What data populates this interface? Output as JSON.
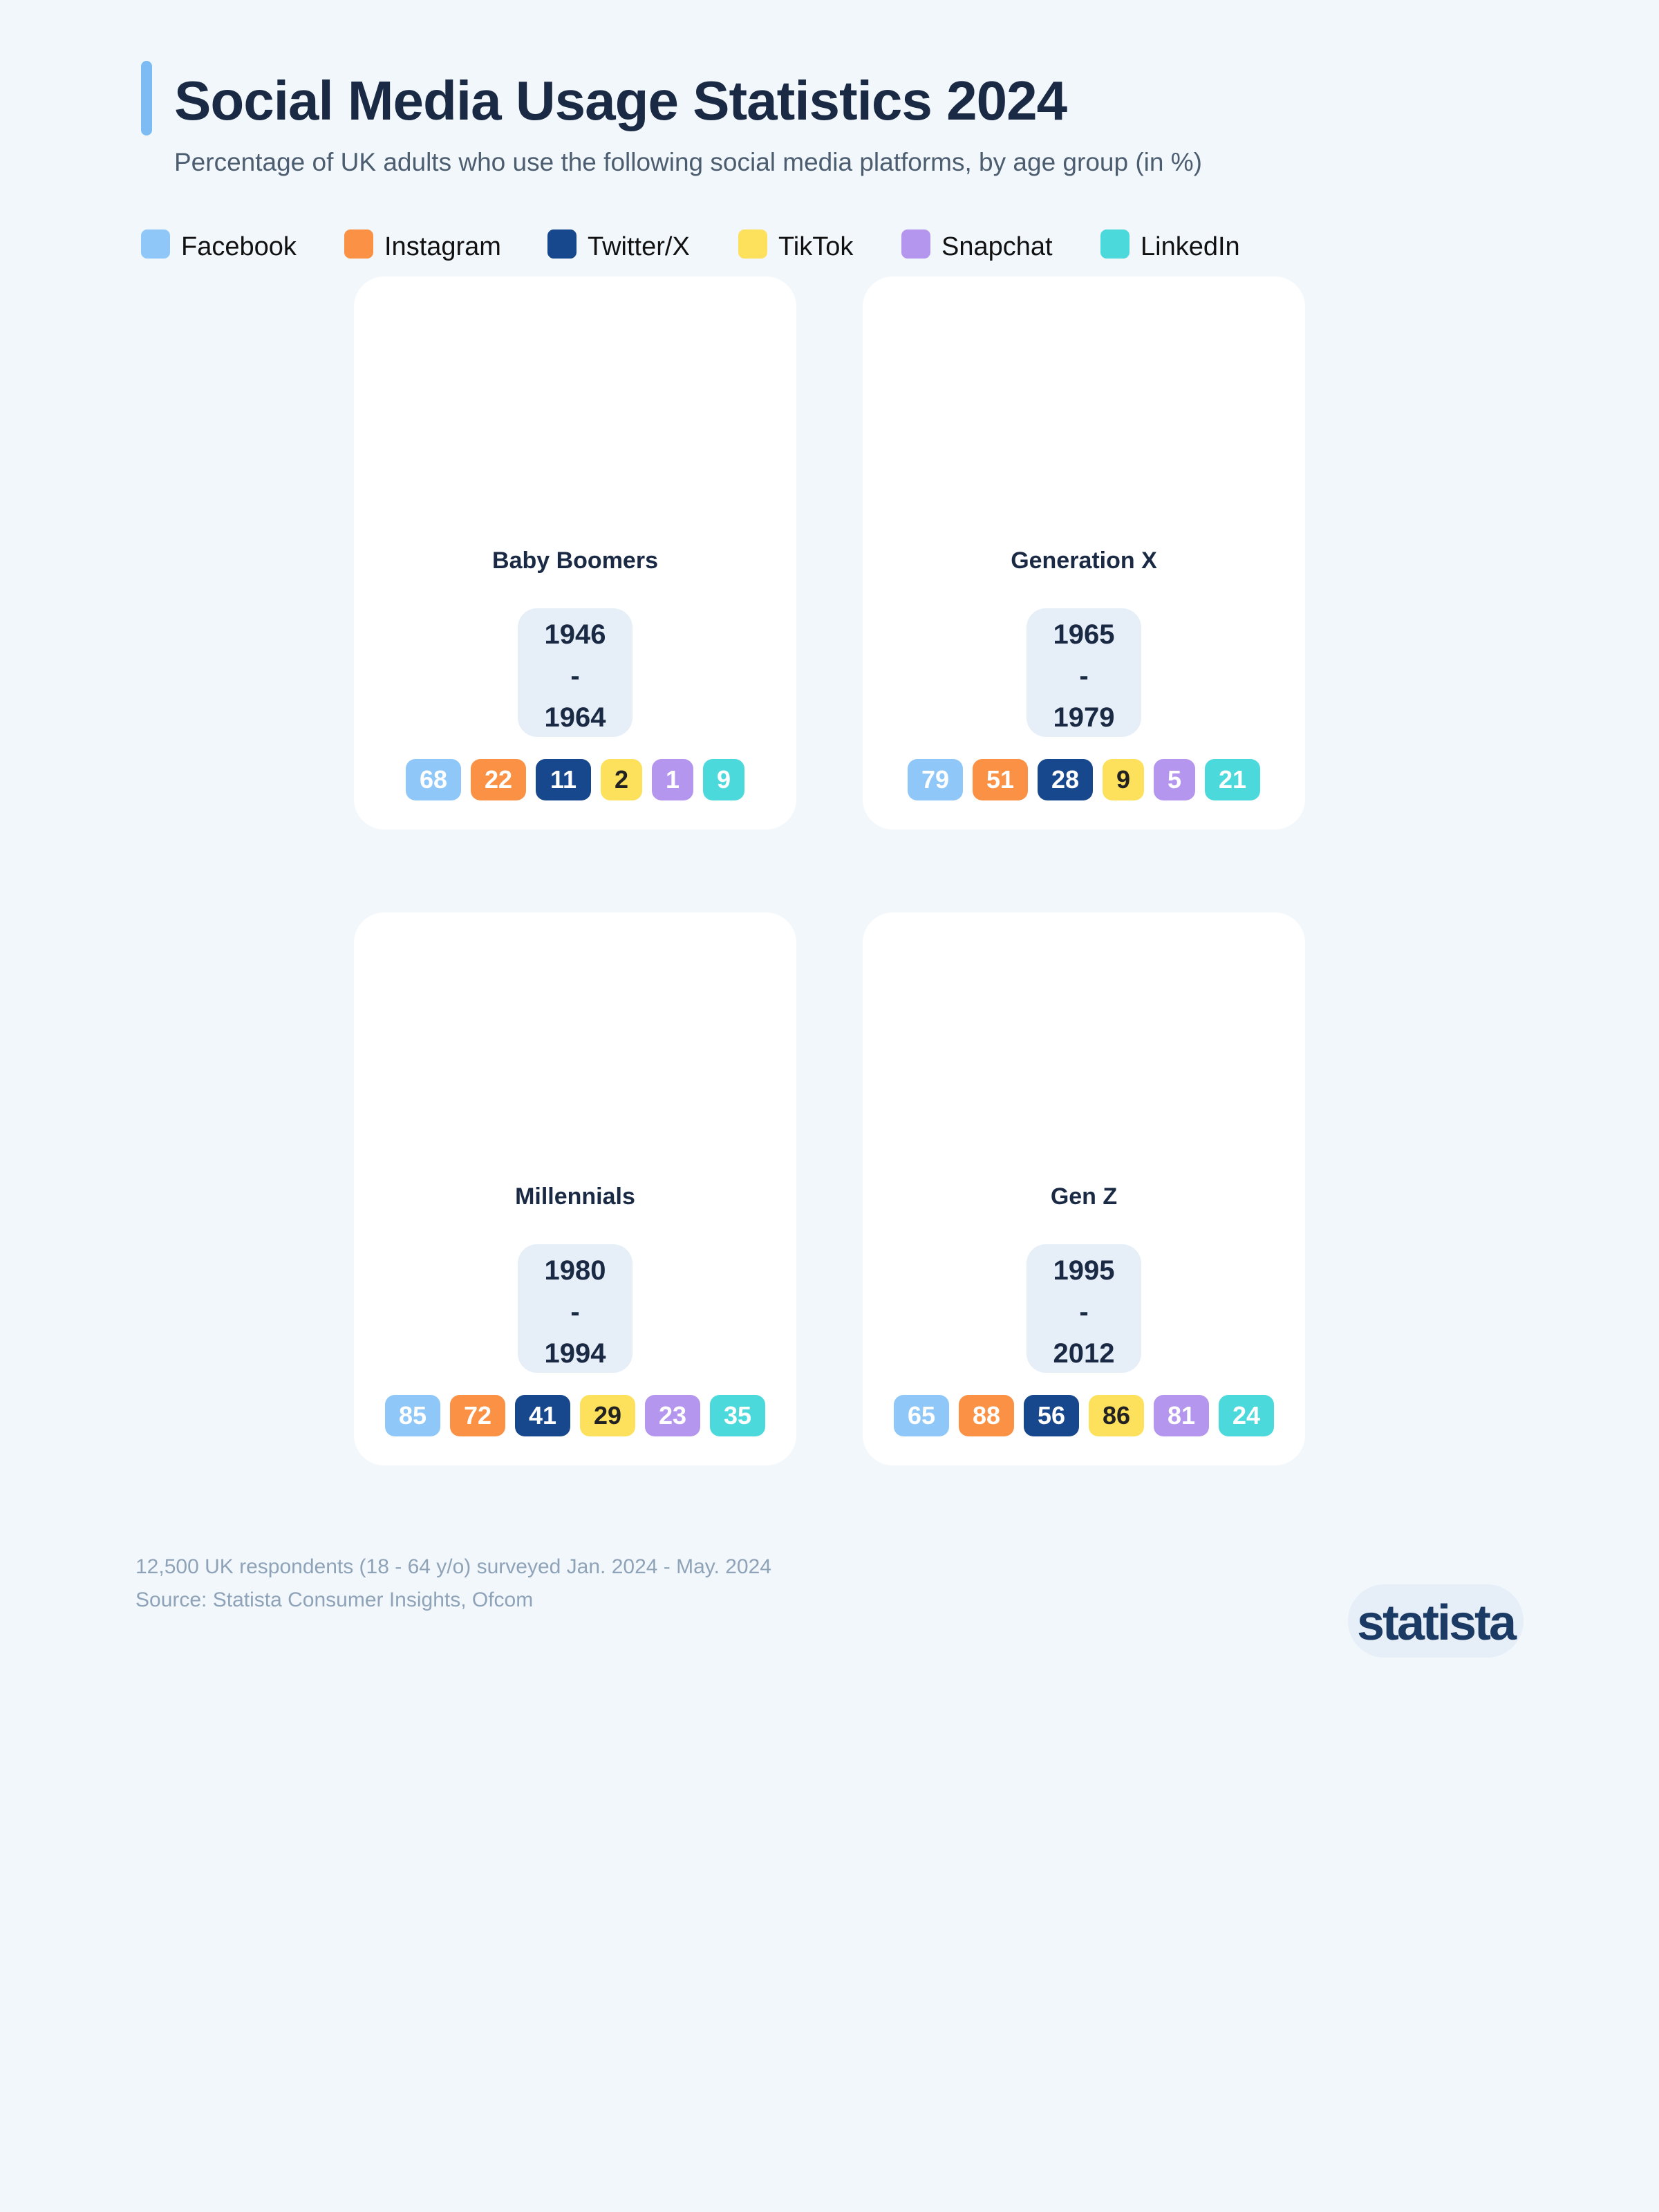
{
  "header": {
    "title": "Social Media Usage Statistics 2024",
    "subtitle": "Percentage of UK adults who use the following social media platforms, by age group (in %)",
    "accent_color": "#7dbbf5"
  },
  "chart_data": {
    "type": "table",
    "title": "Social Media Usage Statistics 2024",
    "subtitle": "Percentage of UK adults who use the following social media platforms, by age group (in %)",
    "unit": "%",
    "series": [
      {
        "name": "Facebook",
        "color": "#8fc8f8"
      },
      {
        "name": "Instagram",
        "color": "#fb9144"
      },
      {
        "name": "Twitter/X",
        "color": "#17478c"
      },
      {
        "name": "TikTok",
        "color": "#fde05b"
      },
      {
        "name": "Snapchat",
        "color": "#b596ef"
      },
      {
        "name": "LinkedIn",
        "color": "#4cd9dc"
      }
    ],
    "groups": [
      {
        "name": "Baby Boomers",
        "years_start": "1946",
        "years_sep": "-",
        "years_end": "1964",
        "values": [
          68,
          22,
          11,
          2,
          1,
          9
        ]
      },
      {
        "name": "Generation X",
        "years_start": "1965",
        "years_sep": "-",
        "years_end": "1979",
        "values": [
          79,
          51,
          28,
          9,
          5,
          21
        ]
      },
      {
        "name": "Millennials",
        "years_start": "1980",
        "years_sep": "-",
        "years_end": "1994",
        "values": [
          85,
          72,
          41,
          29,
          23,
          35
        ]
      },
      {
        "name": "Gen Z",
        "years_start": "1995",
        "years_sep": "-",
        "years_end": "2012",
        "values": [
          65,
          88,
          56,
          86,
          81,
          24
        ]
      }
    ]
  },
  "footer": {
    "note": "12,500 UK respondents (18 - 64 y/o) surveyed Jan. 2024 - May. 2024",
    "source": "Source: Statista Consumer Insights, Ofcom",
    "logo": "statista"
  }
}
